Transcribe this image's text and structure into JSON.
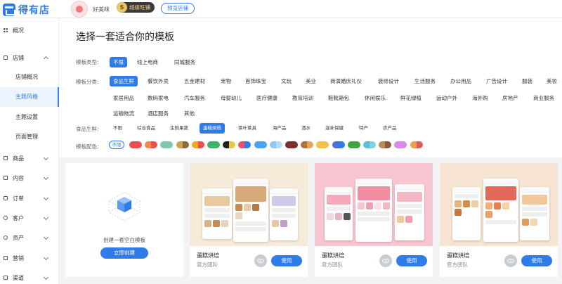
{
  "brand": {
    "name": "得有店"
  },
  "shop": {
    "name": "好美味",
    "level_badge": "S",
    "level_label": "超级旺铺",
    "preview_label": "预览店铺"
  },
  "sidebar": {
    "items": [
      {
        "label": "概况"
      },
      {
        "label": "店铺"
      },
      {
        "label": "商品"
      },
      {
        "label": "内容"
      },
      {
        "label": "订单"
      },
      {
        "label": "客户"
      },
      {
        "label": "资产"
      },
      {
        "label": "营销"
      },
      {
        "label": "渠道"
      }
    ],
    "sub_items": [
      {
        "label": "店铺概况"
      },
      {
        "label": "主题风格"
      },
      {
        "label": "主题设置"
      },
      {
        "label": "页面管理"
      }
    ]
  },
  "main": {
    "title": "选择一套适合你的模板",
    "filters": {
      "type_label": "模板类型:",
      "types": [
        "不限",
        "线上电商",
        "同城服务"
      ],
      "category_label": "模板分类:",
      "categories_row1": [
        "食品生鲜",
        "餐饮外卖",
        "五金建材",
        "宠物",
        "首饰珠宝",
        "文玩",
        "美业",
        "商演婚庆礼仪",
        "装修设计",
        "生活服务",
        "办公用品",
        "广告设计",
        "服装",
        "美妆"
      ],
      "categories_row2": [
        "家居用品",
        "数码家电",
        "汽车服务",
        "母婴幼儿",
        "医疗健康",
        "教育培训",
        "鞋靴箱包",
        "休闲娱乐",
        "鲜花绿植",
        "运动户外",
        "海外购",
        "房地产",
        "商业服务"
      ],
      "categories_row3": [
        "运输物流",
        "酒店服务",
        "其他"
      ],
      "sub_label": "食品生鲜:",
      "subcategories": [
        "不限",
        "综合食品",
        "生鲜果蔬",
        "蛋糕烘焙",
        "茶叶茶具",
        "海产品",
        "酒水",
        "滋补保健",
        "特产",
        "农产品"
      ],
      "color_label": "模板配色:",
      "color_none": "不限"
    },
    "blank_card": {
      "text": "创建一套空白模板",
      "button": "立即创建"
    },
    "templates": [
      {
        "name": "蛋糕烘焙",
        "author": "官方团队",
        "use_label": "使用"
      },
      {
        "name": "蛋糕烘焙",
        "author": "官方团队",
        "use_label": "使用"
      },
      {
        "name": "蛋糕烘焙",
        "author": "官方团队",
        "use_label": "使用"
      }
    ]
  },
  "swatches": [
    [
      "#e94f4f",
      "#e94f4f"
    ],
    [
      "#f2894a",
      "#e94f4f"
    ],
    [
      "#7fc8a9",
      "#7fc8a9"
    ],
    [
      "#c9a15a",
      "#8b6b3a"
    ],
    [
      "#f5a623",
      "#e94f4f"
    ],
    [
      "#3fb56a",
      "#3fb56a"
    ],
    [
      "#222222",
      "#e9c84a"
    ],
    [
      "#e94f6f",
      "#2f7be8"
    ],
    [
      "#4aa3f0",
      "#4aa3f0"
    ],
    [
      "#8fc7f5",
      "#b9dcfa"
    ],
    [
      "#7a2f2f",
      "#7a2f2f"
    ],
    [
      "#b0703a",
      "#e2a85c"
    ],
    [
      "#f3c14a",
      "#f3c14a"
    ],
    [
      "#4a6fd8",
      "#2f7be8"
    ],
    [
      "#3fa63f",
      "#3fa63f"
    ],
    [
      "#5cc0d8",
      "#7fd0e0"
    ],
    [
      "#b98a5a",
      "#8a5a3a"
    ],
    [
      "#d98ae8",
      "#d98ae8"
    ],
    [
      "#e9a04a",
      "#d95f5f"
    ]
  ]
}
